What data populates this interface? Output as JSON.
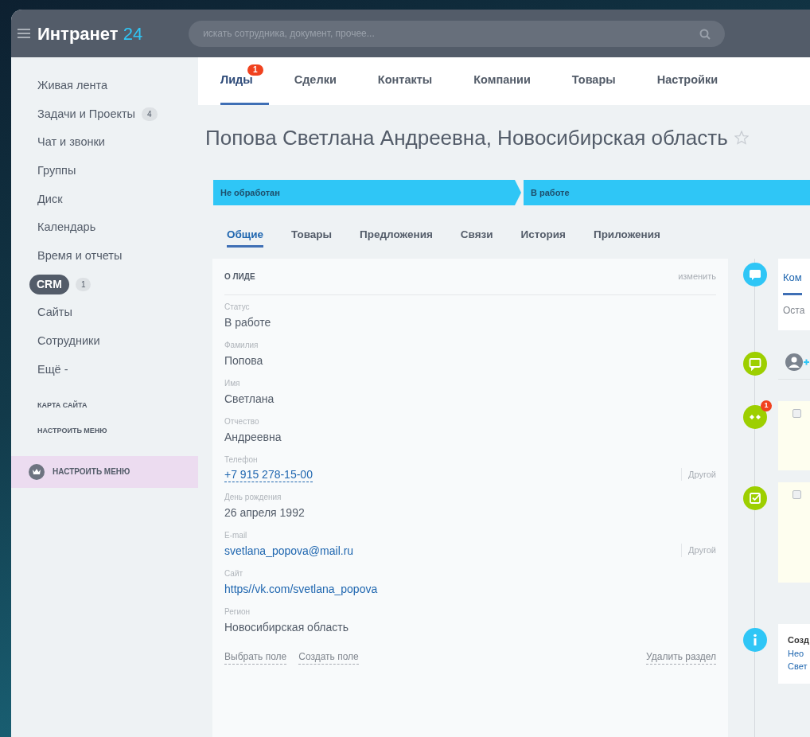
{
  "header": {
    "logo": {
      "text": "Интранет",
      "accent": "24"
    },
    "search": {
      "placeholder": "искать сотрудника, документ, прочее..."
    }
  },
  "sidebar": {
    "items": [
      {
        "label": "Живая лента",
        "selected": false
      },
      {
        "label": "Задачи и Проекты",
        "counter": "4",
        "selected": false
      },
      {
        "label": "Чат и звонки",
        "selected": false
      },
      {
        "label": "Группы",
        "selected": false
      },
      {
        "label": "Диск",
        "selected": false
      },
      {
        "label": "Календарь",
        "selected": false
      },
      {
        "label": "Время и отчеты",
        "selected": false
      },
      {
        "label": "CRM",
        "counter": "1",
        "selected": true
      },
      {
        "label": "Сайты",
        "selected": false
      },
      {
        "label": "Сотрудники",
        "selected": false
      },
      {
        "label": "Ещё -",
        "selected": false
      }
    ],
    "links": [
      "КАРТА САЙТА",
      "НАСТРОИТЬ МЕНЮ"
    ],
    "settings_button": "НАСТРОИТЬ МЕНЮ"
  },
  "top_tabs": [
    {
      "label": "Лиды",
      "badge": "1",
      "selected": true
    },
    {
      "label": "Сделки",
      "selected": false
    },
    {
      "label": "Контакты",
      "selected": false
    },
    {
      "label": "Компании",
      "selected": false
    },
    {
      "label": "Товары",
      "selected": false
    },
    {
      "label": "Настройки",
      "selected": false
    }
  ],
  "title": "Попова Светлана Андреевна, Новосибирская область",
  "stages": [
    {
      "label": "Не обработан"
    },
    {
      "label": "В работе"
    }
  ],
  "detail_tabs": [
    {
      "label": "Общие",
      "selected": true
    },
    {
      "label": "Товары",
      "selected": false
    },
    {
      "label": "Предложения",
      "selected": false
    },
    {
      "label": "Связи",
      "selected": false
    },
    {
      "label": "История",
      "selected": false
    },
    {
      "label": "Приложения",
      "selected": false
    }
  ],
  "card": {
    "title": "О ЛИДЕ",
    "action": "изменить",
    "fields": [
      {
        "label": "Статус",
        "value": "В работе",
        "kind": "text"
      },
      {
        "label": "Фамилия",
        "value": "Попова",
        "kind": "text"
      },
      {
        "label": "Имя",
        "value": "Светлана",
        "kind": "text"
      },
      {
        "label": "Отчество",
        "value": "Андреевна",
        "kind": "text"
      },
      {
        "label": "Телефон",
        "value": "+7 915 278-15-00",
        "kind": "phone",
        "extra": "Другой"
      },
      {
        "label": "День рождения",
        "value": "26 апреля 1992",
        "kind": "text"
      },
      {
        "label": "E-mail",
        "value": "svetlana_popova@mail.ru",
        "kind": "link",
        "extra": "Другой"
      },
      {
        "label": "Сайт",
        "value": "https//vk.com/svetlana_popova",
        "kind": "link"
      },
      {
        "label": "Регион",
        "value": "Новосибирская область",
        "kind": "text"
      }
    ],
    "footer_links": [
      "Выбрать поле",
      "Создать поле"
    ],
    "footer_right": "Удалить раздел"
  },
  "timeline": [
    {
      "kind": "editor",
      "color": "#2fc6f6",
      "tab": "Ком",
      "text": "Оста"
    },
    {
      "kind": "comment",
      "color": "#9dcf00"
    },
    {
      "kind": "activity",
      "color": "#9dcf00",
      "badge": "1",
      "checked": false
    },
    {
      "kind": "task",
      "color": "#9dcf00",
      "checked": false
    },
    {
      "kind": "info",
      "color": "#2fc6f6",
      "heading": "Созд",
      "links": [
        "Нео",
        "Свет"
      ]
    }
  ]
}
